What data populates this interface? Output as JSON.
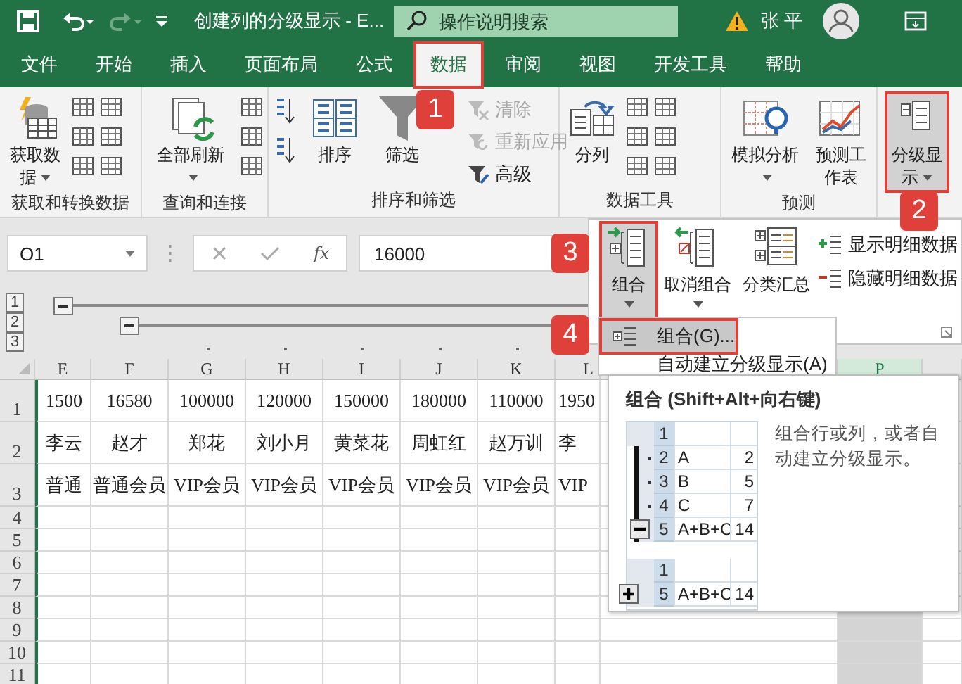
{
  "title_bar": {
    "title": "创建列的分级显示  -  E...",
    "search_placeholder": "操作说明搜索",
    "user": "张 平"
  },
  "tabs": [
    {
      "label": "文件",
      "selected": false,
      "highlighted": false
    },
    {
      "label": "开始",
      "selected": false,
      "highlighted": false
    },
    {
      "label": "插入",
      "selected": false,
      "highlighted": false
    },
    {
      "label": "页面布局",
      "selected": false,
      "highlighted": false
    },
    {
      "label": "公式",
      "selected": false,
      "highlighted": false
    },
    {
      "label": "数据",
      "selected": true,
      "highlighted": true
    },
    {
      "label": "审阅",
      "selected": false,
      "highlighted": false
    },
    {
      "label": "视图",
      "selected": false,
      "highlighted": false
    },
    {
      "label": "开发工具",
      "selected": false,
      "highlighted": false
    },
    {
      "label": "帮助",
      "selected": false,
      "highlighted": false
    }
  ],
  "ribbon": {
    "groups": [
      {
        "label": "获取和转换数据",
        "items": [
          {
            "kind": "large",
            "label": "获取数据",
            "dropdown": true
          }
        ]
      },
      {
        "label": "查询和连接",
        "items": [
          {
            "kind": "large",
            "label": "全部刷新",
            "dropdown": true
          }
        ]
      },
      {
        "label": "排序和筛选",
        "items": [
          {
            "kind": "large",
            "label": "排序"
          },
          {
            "kind": "large",
            "label": "筛选"
          },
          {
            "kind": "small",
            "label": "清除",
            "disabled": true
          },
          {
            "kind": "small",
            "label": "重新应用",
            "disabled": true
          },
          {
            "kind": "small",
            "label": "高级",
            "disabled": false
          }
        ]
      },
      {
        "label": "数据工具",
        "items": [
          {
            "kind": "large",
            "label": "分列"
          }
        ]
      },
      {
        "label": "预测",
        "items": [
          {
            "kind": "large",
            "label": "模拟分析",
            "dropdown": true
          },
          {
            "kind": "large",
            "label": "预测工作表"
          }
        ]
      },
      {
        "items": [
          {
            "kind": "large",
            "label": "分级显示",
            "dropdown": true,
            "open": true,
            "highlighted": true
          }
        ]
      }
    ]
  },
  "formula_bar": {
    "name_box": "O1",
    "function_label": "fx",
    "value": "16000"
  },
  "outline_levels": [
    "1",
    "2",
    "3"
  ],
  "sheet": {
    "columns": [
      {
        "label": "E",
        "selected": false
      },
      {
        "label": "F",
        "selected": false
      },
      {
        "label": "G",
        "selected": false
      },
      {
        "label": "H",
        "selected": false
      },
      {
        "label": "I",
        "selected": false
      },
      {
        "label": "J",
        "selected": false
      },
      {
        "label": "K",
        "selected": false
      },
      {
        "label": "L",
        "selected": false
      },
      {
        "label": "P",
        "selected": true
      }
    ],
    "row_numbers": [
      "1",
      "2",
      "3",
      "4",
      "5",
      "6",
      "7",
      "8",
      "9",
      "10",
      "11"
    ],
    "rows": [
      [
        "1500",
        "16580",
        "100000",
        "120000",
        "150000",
        "180000",
        "110000",
        "1950"
      ],
      [
        "李云",
        "赵才",
        "郑花",
        "刘小月",
        "黄菜花",
        "周虹红",
        "赵万训",
        "李"
      ],
      [
        "普通",
        "普通会员",
        "VIP会员",
        "VIP会员",
        "VIP会员",
        "VIP会员",
        "VIP会员",
        "VIP"
      ]
    ]
  },
  "outline_menu": {
    "items": [
      {
        "kind": "large",
        "label": "组合",
        "dropdown": true,
        "open": true,
        "highlighted": true
      },
      {
        "kind": "large",
        "label": "取消组合",
        "dropdown": true,
        "open": false,
        "highlighted": false
      },
      {
        "kind": "large",
        "label": "分类汇总",
        "open": false,
        "highlighted": false
      },
      {
        "kind": "small",
        "label": "显示明细数据"
      },
      {
        "kind": "small",
        "label": "隐藏明细数据"
      }
    ]
  },
  "group_submenu": {
    "items": [
      {
        "label": "组合(G)...",
        "selected": true,
        "highlighted": true
      },
      {
        "label": "自动建立分级显示(A)",
        "selected": false,
        "highlighted": false
      }
    ]
  },
  "tooltip": {
    "title": "组合 (Shift+Alt+向右键)",
    "description": "组合行或列，或者自动建立分级显示。",
    "tables": [
      {
        "collapsed": false,
        "rows": [
          {
            "kind": "header",
            "row": "1"
          },
          {
            "kind": "detail",
            "row": "2",
            "label": "A",
            "value": "2"
          },
          {
            "kind": "detail",
            "row": "3",
            "label": "B",
            "value": "5"
          },
          {
            "kind": "detail",
            "row": "4",
            "label": "C",
            "value": "7"
          },
          {
            "kind": "summary",
            "row": "5",
            "label": "A+B+C",
            "value": "14"
          }
        ]
      },
      {
        "collapsed": true,
        "rows": [
          {
            "kind": "header",
            "row": "1"
          },
          {
            "kind": "summary",
            "row": "5",
            "label": "A+B+C",
            "value": "14"
          }
        ]
      }
    ]
  },
  "callouts": [
    {
      "label": "1"
    },
    {
      "label": "2"
    },
    {
      "label": "3"
    },
    {
      "label": "4"
    }
  ]
}
